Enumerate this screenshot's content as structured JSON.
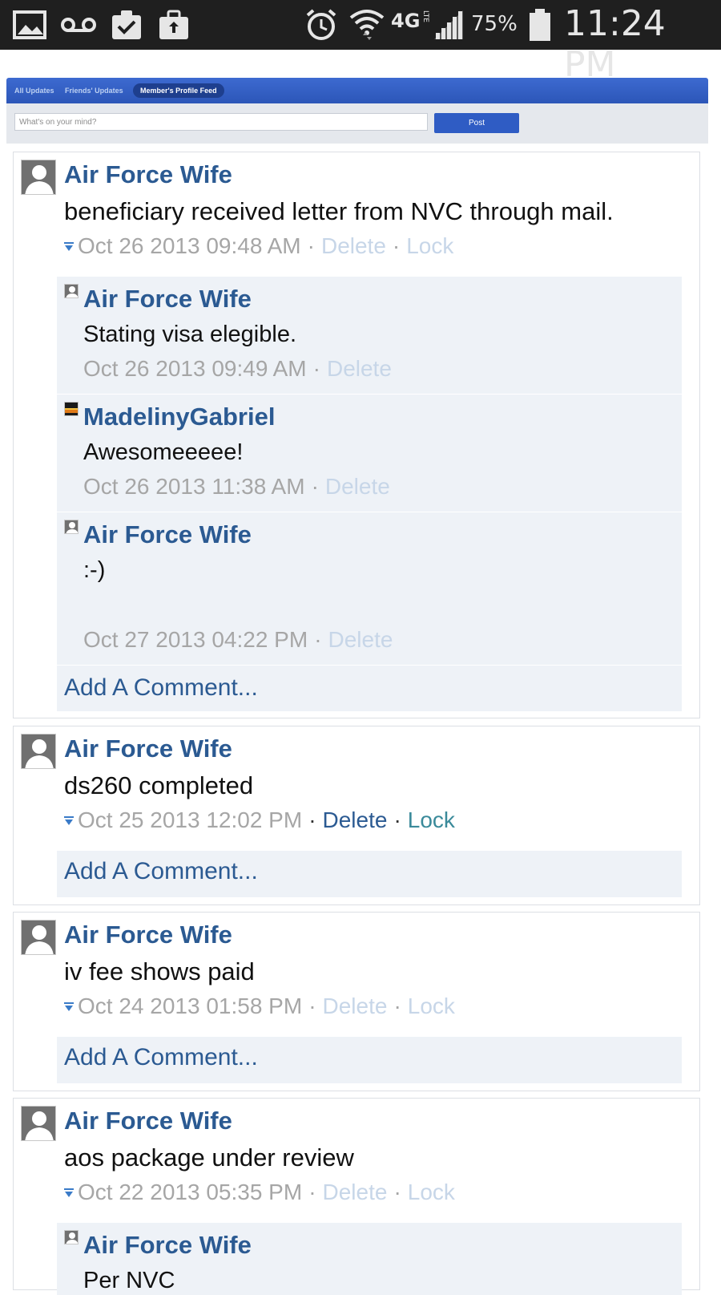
{
  "status_bar": {
    "battery_percent": "75%",
    "network": "4G",
    "network_sub": "LTE",
    "time": "11:24 PM",
    "icons": [
      "gallery-icon",
      "voicemail-icon",
      "clipboard-check-icon",
      "briefcase-upload-icon",
      "alarm-icon",
      "wifi-icon",
      "signal-icon",
      "battery-icon"
    ]
  },
  "tabs": [
    {
      "label": "All Updates",
      "active": false
    },
    {
      "label": "Friends' Updates",
      "active": false
    },
    {
      "label": "Member's Profile Feed",
      "active": true
    }
  ],
  "composer": {
    "placeholder": "What's on your mind?",
    "post_label": "Post"
  },
  "labels": {
    "delete": "Delete",
    "lock": "Lock",
    "add_comment": "Add A Comment..."
  },
  "posts": [
    {
      "author": "Air Force Wife",
      "text": "beneficiary received letter from NVC through mail.",
      "date": "Oct 26 2013 09:48 AM",
      "comments": [
        {
          "author": "Air Force Wife",
          "text": "Stating visa elegible.",
          "date": "Oct 26 2013 09:49 AM"
        },
        {
          "author": "MadelinyGabriel",
          "text": "Awesomeeeee!",
          "date": "Oct 26 2013 11:38 AM"
        },
        {
          "author": "Air Force Wife",
          "text": ":-)",
          "date": "Oct 27 2013 04:22 PM"
        }
      ]
    },
    {
      "author": "Air Force Wife",
      "text": "ds260 completed",
      "date": "Oct 25 2013 12:02 PM",
      "comments": []
    },
    {
      "author": "Air Force Wife",
      "text": "iv fee shows paid",
      "date": "Oct 24 2013 01:58 PM",
      "comments": []
    },
    {
      "author": "Air Force Wife",
      "text": "aos package under review",
      "date": "Oct 22 2013 05:35 PM",
      "comments": [
        {
          "author": "Air Force Wife",
          "text": "Per NVC",
          "date": ""
        }
      ]
    }
  ],
  "colors": {
    "link": "#2b5a92",
    "tab_bar": "#2c56b8",
    "comment_bg": "#eef2f7"
  }
}
